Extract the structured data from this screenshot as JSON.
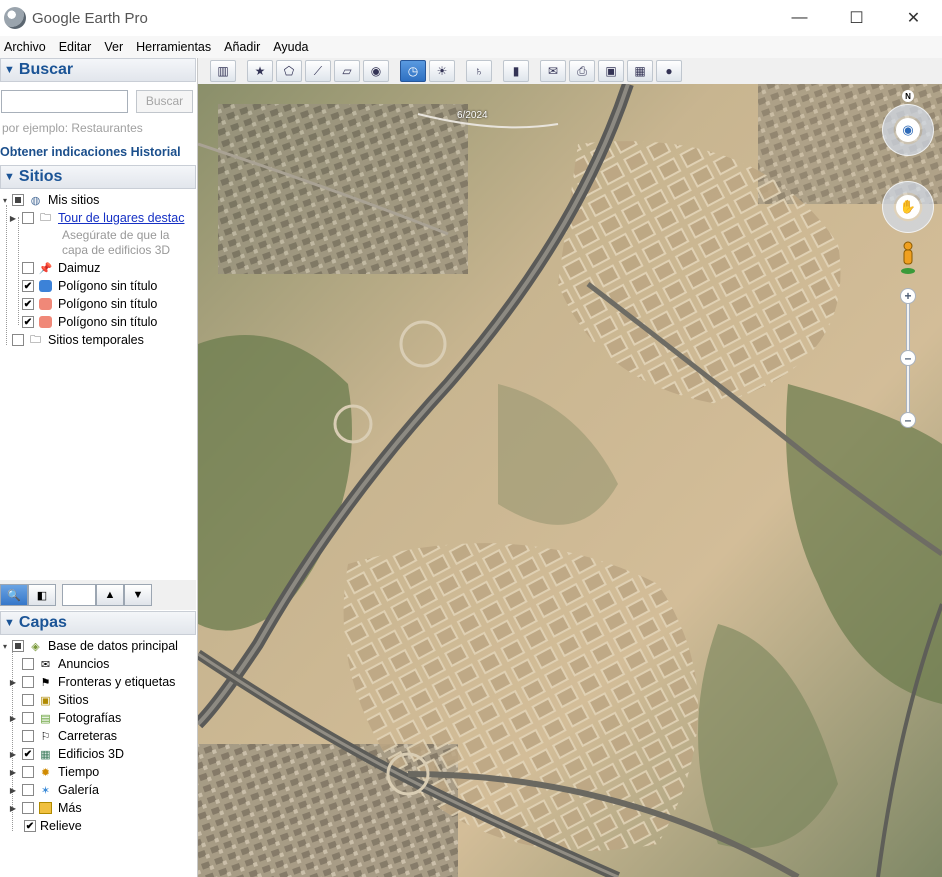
{
  "window": {
    "title": "Google Earth Pro",
    "minimize": "—",
    "maximize": "☐",
    "close": "✕"
  },
  "menu": [
    {
      "label": "Archivo"
    },
    {
      "label": "Editar"
    },
    {
      "label": "Ver"
    },
    {
      "label": "Herramientas"
    },
    {
      "label": "Añadir"
    },
    {
      "label": "Ayuda"
    }
  ],
  "search": {
    "header": "Buscar",
    "input_value": "",
    "button_label": "Buscar",
    "hint": "por ejemplo: Restaurantes",
    "link_directions": "Obtener indicaciones",
    "link_history": "Historial"
  },
  "places": {
    "header": "Sitios",
    "my_places": "Mis sitios",
    "tour_link": "Tour de lugares destac",
    "tour_desc_1": "Asegúrate de que la",
    "tour_desc_2": "capa de edificios 3D",
    "item_daimuz": "Daimuz",
    "polygon_1": "Polígono sin título",
    "polygon_2": "Polígono sin título",
    "polygon_3": "Polígono sin título",
    "temp_places": "Sitios temporales"
  },
  "layers": {
    "header": "Capas",
    "primary_db": "Base de datos principal",
    "items": [
      {
        "label": "Anuncios",
        "checked": false
      },
      {
        "label": "Fronteras y etiquetas",
        "checked": false
      },
      {
        "label": "Sitios",
        "checked": false
      },
      {
        "label": "Fotografías",
        "checked": false
      },
      {
        "label": "Carreteras",
        "checked": false
      },
      {
        "label": "Edificios 3D",
        "checked": true
      },
      {
        "label": "Tiempo",
        "checked": false
      },
      {
        "label": "Galería",
        "checked": false
      },
      {
        "label": "Más",
        "checked": false
      }
    ],
    "terrain": "Relieve"
  },
  "map": {
    "date": "6/2024",
    "north": "N"
  },
  "colors": {
    "header_blue": "#1b5496",
    "link_blue": "#1530c4",
    "active_tool": "#2e70c2"
  }
}
